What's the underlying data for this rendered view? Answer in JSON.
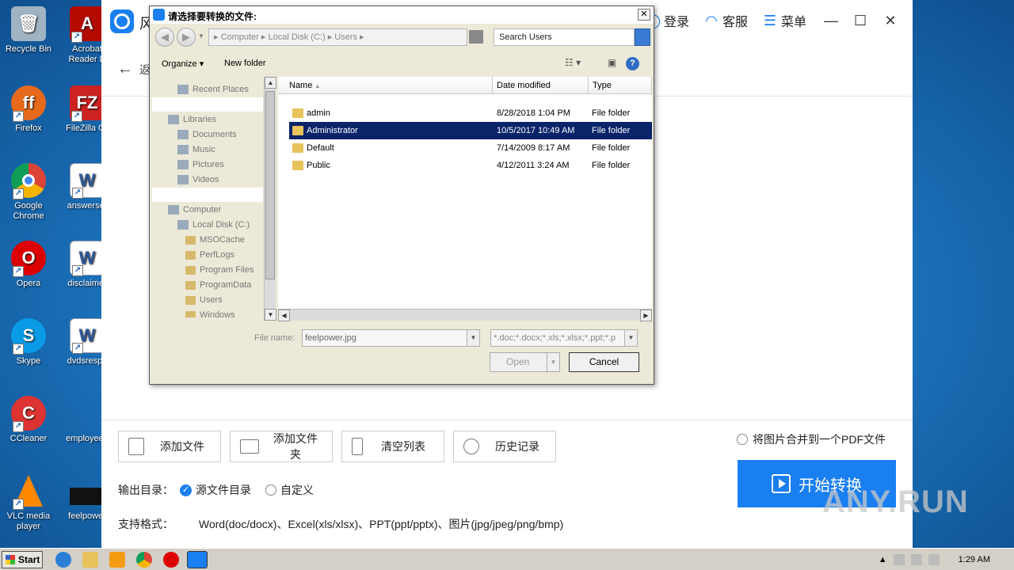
{
  "desktop": {
    "icons": [
      {
        "label": "Recycle Bin",
        "name": "recycle-bin-icon",
        "color": "#8aa"
      },
      {
        "label": "Acrobat Reader D",
        "name": "acrobat-reader-icon",
        "color": "#c00"
      },
      {
        "label": "Firefox",
        "name": "firefox-icon",
        "color": "#e76a1c"
      },
      {
        "label": "FileZilla Cli",
        "name": "filezilla-icon",
        "color": "#c22"
      },
      {
        "label": "Google Chrome",
        "name": "chrome-icon",
        "color": "#3a8a3a"
      },
      {
        "label": "answerser",
        "name": "word-doc-icon",
        "color": "#2b5797"
      },
      {
        "label": "Opera",
        "name": "opera-icon",
        "color": "#d00"
      },
      {
        "label": "disclaimer",
        "name": "word-doc-icon",
        "color": "#2b5797"
      },
      {
        "label": "Skype",
        "name": "skype-icon",
        "color": "#0a9be6"
      },
      {
        "label": "dvdsrespe",
        "name": "word-doc-icon",
        "color": "#2b5797"
      },
      {
        "label": "CCleaner",
        "name": "ccleaner-icon",
        "color": "#d33"
      },
      {
        "label": "employeep",
        "name": "file-icon",
        "color": "#888"
      },
      {
        "label": "VLC media player",
        "name": "vlc-icon",
        "color": "#f80"
      },
      {
        "label": "feelpower",
        "name": "image-file-icon",
        "color": "#111"
      }
    ]
  },
  "app": {
    "title": "风",
    "login": "登录",
    "service": "客服",
    "menu": "菜单",
    "back": "返",
    "toolbar": {
      "add_file": "添加文件",
      "add_folder": "添加文件夹",
      "clear_list": "清空列表",
      "history": "历史记录"
    },
    "merge_label": "将图片合并到一个PDF文件",
    "output_label": "输出目录：",
    "output_source": "源文件目录",
    "output_custom": "自定义",
    "start": "开始转换",
    "formats_label": "支持格式：",
    "formats_value": "Word(doc/docx)、Excel(xls/xlsx)、PPT(ppt/pptx)、图片(jpg/jpeg/png/bmp)",
    "accent": "#1a7ff0"
  },
  "dialog": {
    "title": "请选择要转换的文件:",
    "address": "▸ Computer  ▸ Local Disk (C:)  ▸ Users  ▸",
    "search_placeholder": "Search Users",
    "organize": "Organize",
    "new_folder": "New folder",
    "nav": {
      "recent": "Recent Places",
      "libraries": "Libraries",
      "documents": "Documents",
      "music": "Music",
      "pictures": "Pictures",
      "videos": "Videos",
      "computer": "Computer",
      "local_disk": "Local Disk (C:)",
      "folders": [
        "MSOCache",
        "PerfLogs",
        "Program Files",
        "ProgramData",
        "Users",
        "Windows"
      ]
    },
    "columns": {
      "name": "Name",
      "date": "Date modified",
      "type": "Type"
    },
    "rows": [
      {
        "name": "admin",
        "date": "8/28/2018 1:04 PM",
        "type": "File folder"
      },
      {
        "name": "Administrator",
        "date": "10/5/2017 10:49 AM",
        "type": "File folder"
      },
      {
        "name": "Default",
        "date": "7/14/2009 8:17 AM",
        "type": "File folder"
      },
      {
        "name": "Public",
        "date": "4/12/2011 3:24 AM",
        "type": "File folder"
      }
    ],
    "file_name_label": "File name:",
    "file_name_value": "feelpower.jpg",
    "file_type_value": "*.doc;*.docx;*.xls;*.xlsx;*.ppt;*.p",
    "open": "Open",
    "cancel": "Cancel"
  },
  "taskbar": {
    "start": "Start",
    "clock": "1:29 AM"
  },
  "watermark": "ANY.RUN"
}
